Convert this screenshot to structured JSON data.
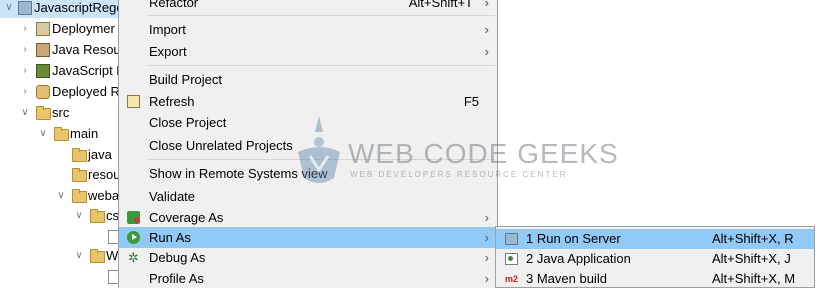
{
  "tree": {
    "items": [
      {
        "label": "JavascriptRege",
        "icon": "project-icon",
        "selected": true
      },
      {
        "label": "Deploymer",
        "icon": "deployment-descriptor-icon"
      },
      {
        "label": "Java Resour",
        "icon": "java-resources-icon"
      },
      {
        "label": "JavaScript R",
        "icon": "javascript-resources-icon"
      },
      {
        "label": "Deployed R",
        "icon": "deployed-resources-icon"
      },
      {
        "label": "src",
        "icon": "folder-icon"
      },
      {
        "label": "main",
        "icon": "folder-icon"
      },
      {
        "label": "java",
        "icon": "folder-icon"
      },
      {
        "label": "resou",
        "icon": "folder-icon"
      },
      {
        "label": "weba",
        "icon": "folder-icon"
      },
      {
        "label": "cs",
        "icon": "folder-icon"
      },
      {
        "label": "",
        "icon": "file-icon"
      },
      {
        "label": "W",
        "icon": "folder-icon"
      },
      {
        "label": "",
        "icon": "xml-file-icon"
      }
    ]
  },
  "menu": {
    "refactor": {
      "label": "Refactor",
      "shortcut": "Alt+Shift+T"
    },
    "import": {
      "label": "Import"
    },
    "export": {
      "label": "Export"
    },
    "build_project": {
      "label": "Build Project"
    },
    "refresh": {
      "label": "Refresh",
      "shortcut": "F5"
    },
    "close_project": {
      "label": "Close Project"
    },
    "close_unrelated": {
      "label": "Close Unrelated Projects"
    },
    "show_remote": {
      "label": "Show in Remote Systems view"
    },
    "validate": {
      "label": "Validate"
    },
    "coverage_as": {
      "label": "Coverage As"
    },
    "run_as": {
      "label": "Run As"
    },
    "debug_as": {
      "label": "Debug As"
    },
    "profile_as": {
      "label": "Profile As"
    }
  },
  "submenu": {
    "items": [
      {
        "label": "1 Run on Server",
        "shortcut": "Alt+Shift+X, R",
        "icon": "server-icon"
      },
      {
        "label": "2 Java Application",
        "shortcut": "Alt+Shift+X, J",
        "icon": "java-app-icon"
      },
      {
        "label": "3 Maven build",
        "shortcut": "Alt+Shift+X, M",
        "icon": "maven-m2-icon"
      }
    ]
  },
  "watermark": {
    "title": "WEB CODE GEEKS",
    "subtitle": "WEB DEVELOPERS RESOURCE CENTER"
  },
  "colors": {
    "menu_highlight": "#91c9f7",
    "menu_background": "#f0f0f0",
    "tree_selection": "#cce4f7"
  }
}
